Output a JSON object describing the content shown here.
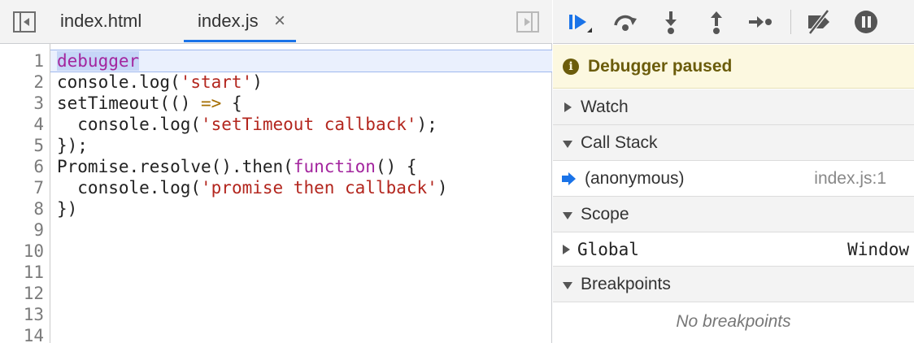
{
  "editor": {
    "tabs": [
      {
        "label": "index.html"
      },
      {
        "label": "index.js",
        "close": "×"
      }
    ],
    "lines": [
      {
        "n": "1",
        "text": "debugger"
      },
      {
        "n": "2",
        "pre": "console.log(",
        "str": "'start'",
        "post": ")"
      },
      {
        "n": "3",
        "pre": "setTimeout(() ",
        "arrow": "=>",
        "post": " {"
      },
      {
        "n": "4",
        "pre": "  console.log(",
        "str": "'setTimeout callback'",
        "post": ");"
      },
      {
        "n": "5",
        "text": "});"
      },
      {
        "n": "6",
        "pre": "Promise.resolve().then(",
        "kw": "function",
        "post": "() {"
      },
      {
        "n": "7",
        "pre": "  console.log(",
        "str": "'promise then callback'",
        "post": ")"
      },
      {
        "n": "8",
        "text": "})"
      },
      {
        "n": "9",
        "text": ""
      },
      {
        "n": "10",
        "text": ""
      },
      {
        "n": "11",
        "text": ""
      },
      {
        "n": "12",
        "text": ""
      },
      {
        "n": "13",
        "text": ""
      },
      {
        "n": "14",
        "text": ""
      }
    ]
  },
  "debugger": {
    "paused_text": "Debugger paused",
    "paused_icon": "i",
    "sections": {
      "watch": "Watch",
      "call_stack": "Call Stack",
      "scope": "Scope",
      "breakpoints": "Breakpoints"
    },
    "frame": {
      "name": "(anonymous)",
      "location": "index.js:1"
    },
    "global": {
      "name": "Global",
      "value": "Window"
    },
    "no_breakpoints": "No breakpoints"
  },
  "colors": {
    "accent": "#1a73e8",
    "paused_bg": "#fcf8e0",
    "paused_text": "#6b5c0b",
    "keyword": "#a3259e",
    "string": "#b3261e"
  }
}
